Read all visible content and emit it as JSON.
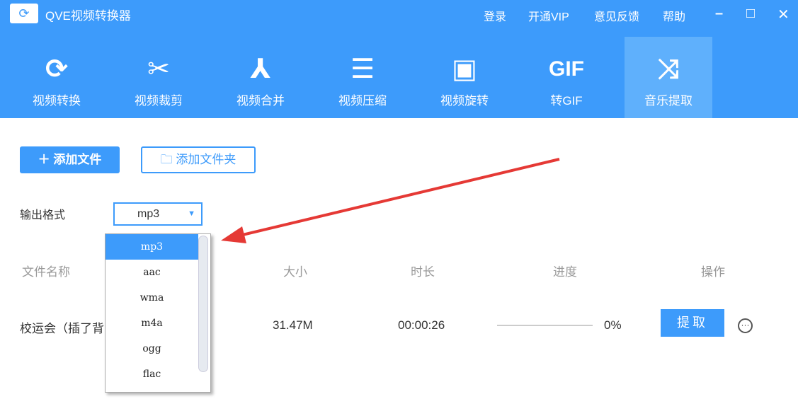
{
  "app": {
    "title": "QVE视频转换器",
    "menu": [
      "登录",
      "开通VIP",
      "意见反馈",
      "帮助"
    ]
  },
  "tools": [
    {
      "label": "视频转换",
      "icon": "⟳"
    },
    {
      "label": "视频裁剪",
      "icon": "✂"
    },
    {
      "label": "视频合并",
      "icon": "⅄"
    },
    {
      "label": "视频压缩",
      "icon": "☰"
    },
    {
      "label": "视频旋转",
      "icon": "▣"
    },
    {
      "label": "转GIF",
      "icon": "GIF"
    },
    {
      "label": "音乐提取",
      "icon": "⤨"
    }
  ],
  "actions": {
    "add_file": "＋ 添加文件",
    "add_folder": "添加文件夹"
  },
  "format": {
    "label": "输出格式",
    "value": "mp3",
    "options": [
      "mp3",
      "aac",
      "wma",
      "m4a",
      "ogg",
      "flac"
    ]
  },
  "table": {
    "headers": [
      "文件名称",
      "大小",
      "时长",
      "进度",
      "操作"
    ],
    "row": {
      "name": "校运会（插了背",
      "size": "31.47M",
      "duration": "00:00:26",
      "progress": "0%",
      "action": "提取"
    }
  }
}
